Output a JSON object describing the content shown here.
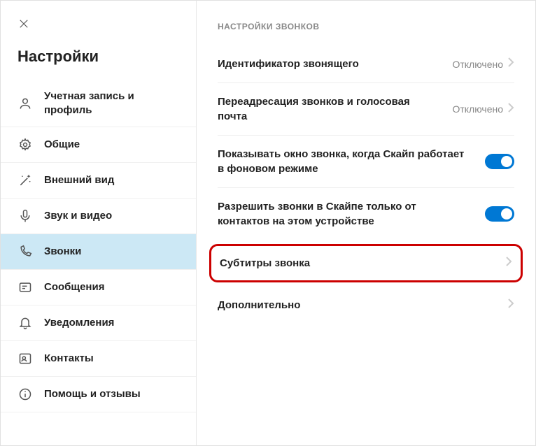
{
  "sidebar": {
    "title": "Настройки",
    "items": [
      {
        "label": "Учетная запись и профиль"
      },
      {
        "label": "Общие"
      },
      {
        "label": "Внешний вид"
      },
      {
        "label": "Звук и видео"
      },
      {
        "label": "Звонки"
      },
      {
        "label": "Сообщения"
      },
      {
        "label": "Уведомления"
      },
      {
        "label": "Контакты"
      },
      {
        "label": "Помощь и отзывы"
      }
    ]
  },
  "content": {
    "section_header": "НАСТРОЙКИ ЗВОНКОВ",
    "settings": {
      "caller_id": {
        "label": "Идентификатор звонящего",
        "value": "Отключено"
      },
      "forwarding": {
        "label": "Переадресация звонков и голосовая почта",
        "value": "Отключено"
      },
      "show_window": {
        "label": "Показывать окно звонка, когда Скайп работает в фоновом режиме",
        "on": true
      },
      "allow_contacts": {
        "label": "Разрешить звонки в Скайпе только от контактов на этом устройстве",
        "on": true
      },
      "subtitles": {
        "label": "Субтитры звонка"
      },
      "advanced": {
        "label": "Дополнительно"
      }
    }
  }
}
